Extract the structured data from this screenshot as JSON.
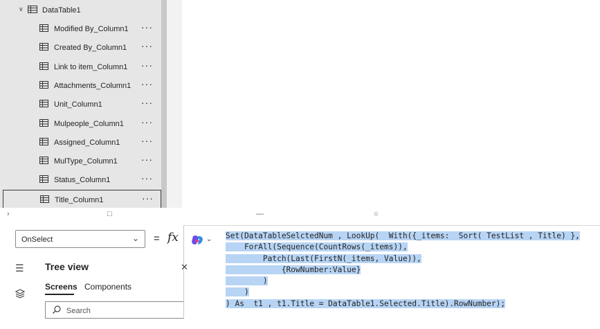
{
  "tree": {
    "parent": {
      "label": "DataTable1",
      "expanded": true
    },
    "columns": [
      {
        "label": "Modified By_Column1"
      },
      {
        "label": "Created By_Column1"
      },
      {
        "label": "Link to item_Column1"
      },
      {
        "label": "Attachments_Column1"
      },
      {
        "label": "Unit_Column1"
      },
      {
        "label": "Mulpeople_Column1"
      },
      {
        "label": "Assigned_Column1"
      },
      {
        "label": "MulType_Column1"
      },
      {
        "label": "Status_Column1"
      },
      {
        "label": "Title_Column1",
        "selected": true
      }
    ],
    "more_label": "···"
  },
  "formula_bar": {
    "property": "OnSelect",
    "equals": "=",
    "fx": "fx",
    "code_lines": [
      "Set(DataTableSelctedNum , LookUp(  With({_items:  Sort( TestList , Title) },",
      "    ForAll(Sequence(CountRows(_items)),",
      "        Patch(Last(FirstN(_items, Value)),",
      "            {RowNumber:Value}",
      "        )",
      "    )",
      ") As  t1 , t1.Title = DataTable1.Selected.Title).RowNumber);"
    ]
  },
  "left_panel": {
    "title": "Tree view",
    "tabs": [
      "Screens",
      "Components"
    ],
    "search_placeholder": "Search"
  },
  "colors": {
    "panel_bg": "#e6e6e6",
    "selection_highlight": "#b7d4f4",
    "accent": "#242424"
  }
}
